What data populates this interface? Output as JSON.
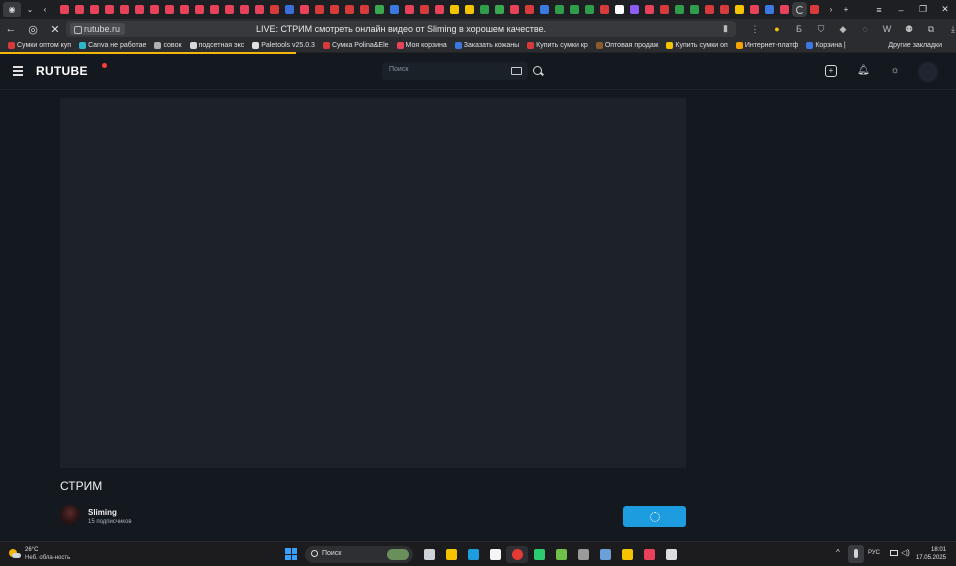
{
  "browser": {
    "url": "rutube.ru",
    "page_title": "LIVE: СТРИМ смотреть онлайн видео от Sliming в хорошем качестве.",
    "tab_colors": [
      "#e8425a",
      "#e8425a",
      "#e8425a",
      "#e8425a",
      "#e8425a",
      "#e8425a",
      "#e8425a",
      "#e8425a",
      "#e8425a",
      "#e8425a",
      "#e8425a",
      "#e8425a",
      "#e8425a",
      "#e8425a",
      "#d73a3a",
      "#3b6ed8",
      "#e8425a",
      "#d73a3a",
      "#d73a3a",
      "#d73a3a",
      "#d73a3a",
      "#3aa84f",
      "#3b78e0",
      "#e8425a",
      "#d73a3a",
      "#e8425a",
      "#f5c400",
      "#f5c400",
      "#2e9e4a",
      "#3aa84f",
      "#e8425a",
      "#d73a3a",
      "#3b78e0",
      "#2e9e4a",
      "#2e9e4a",
      "#2e9e4a",
      "#d73a3a",
      "#ffffff",
      "#8d5cf6",
      "#e8425a",
      "#d73a3a",
      "#2e9e4a",
      "#2e9e4a",
      "#d73a3a",
      "#d73a3a",
      "#f5c400",
      "#e8425a",
      "#3b78e0",
      "#e8425a",
      "#d73a3a"
    ],
    "bookmarks": [
      {
        "label": "Сумки оптом куп",
        "color": "#d73a3a"
      },
      {
        "label": "Canva не работае",
        "color": "#2eb8c8"
      },
      {
        "label": "совок",
        "color": "#b0b0b0"
      },
      {
        "label": "подсетная экс",
        "color": "#d9d9d9"
      },
      {
        "label": "Paletools v25.0.3",
        "color": "#e0e0e0"
      },
      {
        "label": "Сумка Polina&Ele",
        "color": "#d73a3a"
      },
      {
        "label": "Моя корзина",
        "color": "#e8425a"
      },
      {
        "label": "Заказать кожаны",
        "color": "#3b78e0"
      },
      {
        "label": "Купить сумки кр",
        "color": "#d73a3a"
      },
      {
        "label": "Оптовая продаж",
        "color": "#8b5a2b"
      },
      {
        "label": "Купить сумки оп",
        "color": "#f5c400"
      },
      {
        "label": "Интернет-платф",
        "color": "#f5a300"
      },
      {
        "label": "Корзина |",
        "color": "#3b78e0"
      }
    ],
    "other_bookmarks": "Другие закладки"
  },
  "header": {
    "logo": "RUTUBE",
    "search_placeholder": "Поиск"
  },
  "video": {
    "title": "СТРИМ",
    "channel_name": "Sliming",
    "subscribers": "15 подписчиков"
  },
  "taskbar": {
    "temperature": "26°C",
    "weather": "Неб. обла-ность",
    "search_placeholder": "Поиск",
    "apps": [
      {
        "name": "task-view-icon",
        "color": "#cfd3d8"
      },
      {
        "name": "file-explorer-icon",
        "color": "#f5c400"
      },
      {
        "name": "edge-icon",
        "color": "#1e9ce0"
      },
      {
        "name": "store-icon",
        "color": "#f5f5f5"
      },
      {
        "name": "yandex-browser-icon",
        "color": "#ffffff",
        "active": true
      },
      {
        "name": "whatsapp-icon",
        "color": "#2ecc71"
      },
      {
        "name": "minecraft-icon",
        "color": "#6fbf4a"
      },
      {
        "name": "app-icon",
        "color": "#9a9a9a"
      },
      {
        "name": "steam-icon",
        "color": "#6a9fd8"
      },
      {
        "name": "chrome-icon",
        "color": "#f5c400"
      },
      {
        "name": "game-icon",
        "color": "#e8425a"
      },
      {
        "name": "obs-icon",
        "color": "#dddddd"
      }
    ],
    "language": "РУС",
    "time": "18:01",
    "date": "17.05.2025"
  }
}
